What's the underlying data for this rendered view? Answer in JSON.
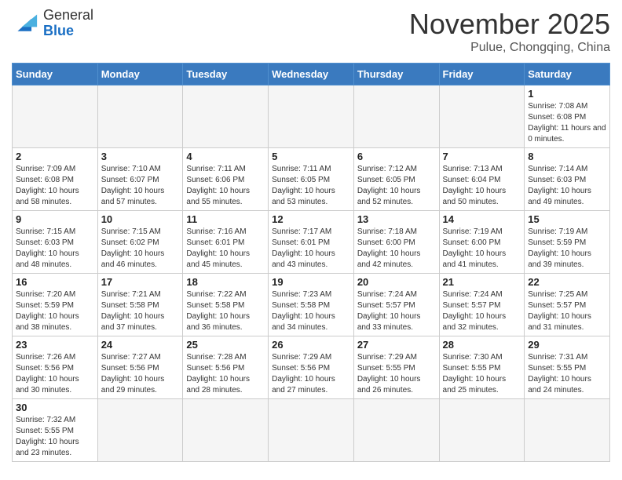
{
  "header": {
    "logo": {
      "general": "General",
      "blue": "Blue"
    },
    "title": "November 2025",
    "location": "Pulue, Chongqing, China"
  },
  "weekdays": [
    "Sunday",
    "Monday",
    "Tuesday",
    "Wednesday",
    "Thursday",
    "Friday",
    "Saturday"
  ],
  "weeks": [
    [
      {
        "day": null,
        "info": null
      },
      {
        "day": null,
        "info": null
      },
      {
        "day": null,
        "info": null
      },
      {
        "day": null,
        "info": null
      },
      {
        "day": null,
        "info": null
      },
      {
        "day": null,
        "info": null
      },
      {
        "day": "1",
        "info": "Sunrise: 7:08 AM\nSunset: 6:08 PM\nDaylight: 11 hours and 0 minutes."
      }
    ],
    [
      {
        "day": "2",
        "info": "Sunrise: 7:09 AM\nSunset: 6:08 PM\nDaylight: 10 hours and 58 minutes."
      },
      {
        "day": "3",
        "info": "Sunrise: 7:10 AM\nSunset: 6:07 PM\nDaylight: 10 hours and 57 minutes."
      },
      {
        "day": "4",
        "info": "Sunrise: 7:11 AM\nSunset: 6:06 PM\nDaylight: 10 hours and 55 minutes."
      },
      {
        "day": "5",
        "info": "Sunrise: 7:11 AM\nSunset: 6:05 PM\nDaylight: 10 hours and 53 minutes."
      },
      {
        "day": "6",
        "info": "Sunrise: 7:12 AM\nSunset: 6:05 PM\nDaylight: 10 hours and 52 minutes."
      },
      {
        "day": "7",
        "info": "Sunrise: 7:13 AM\nSunset: 6:04 PM\nDaylight: 10 hours and 50 minutes."
      },
      {
        "day": "8",
        "info": "Sunrise: 7:14 AM\nSunset: 6:03 PM\nDaylight: 10 hours and 49 minutes."
      }
    ],
    [
      {
        "day": "9",
        "info": "Sunrise: 7:15 AM\nSunset: 6:03 PM\nDaylight: 10 hours and 48 minutes."
      },
      {
        "day": "10",
        "info": "Sunrise: 7:15 AM\nSunset: 6:02 PM\nDaylight: 10 hours and 46 minutes."
      },
      {
        "day": "11",
        "info": "Sunrise: 7:16 AM\nSunset: 6:01 PM\nDaylight: 10 hours and 45 minutes."
      },
      {
        "day": "12",
        "info": "Sunrise: 7:17 AM\nSunset: 6:01 PM\nDaylight: 10 hours and 43 minutes."
      },
      {
        "day": "13",
        "info": "Sunrise: 7:18 AM\nSunset: 6:00 PM\nDaylight: 10 hours and 42 minutes."
      },
      {
        "day": "14",
        "info": "Sunrise: 7:19 AM\nSunset: 6:00 PM\nDaylight: 10 hours and 41 minutes."
      },
      {
        "day": "15",
        "info": "Sunrise: 7:19 AM\nSunset: 5:59 PM\nDaylight: 10 hours and 39 minutes."
      }
    ],
    [
      {
        "day": "16",
        "info": "Sunrise: 7:20 AM\nSunset: 5:59 PM\nDaylight: 10 hours and 38 minutes."
      },
      {
        "day": "17",
        "info": "Sunrise: 7:21 AM\nSunset: 5:58 PM\nDaylight: 10 hours and 37 minutes."
      },
      {
        "day": "18",
        "info": "Sunrise: 7:22 AM\nSunset: 5:58 PM\nDaylight: 10 hours and 36 minutes."
      },
      {
        "day": "19",
        "info": "Sunrise: 7:23 AM\nSunset: 5:58 PM\nDaylight: 10 hours and 34 minutes."
      },
      {
        "day": "20",
        "info": "Sunrise: 7:24 AM\nSunset: 5:57 PM\nDaylight: 10 hours and 33 minutes."
      },
      {
        "day": "21",
        "info": "Sunrise: 7:24 AM\nSunset: 5:57 PM\nDaylight: 10 hours and 32 minutes."
      },
      {
        "day": "22",
        "info": "Sunrise: 7:25 AM\nSunset: 5:57 PM\nDaylight: 10 hours and 31 minutes."
      }
    ],
    [
      {
        "day": "23",
        "info": "Sunrise: 7:26 AM\nSunset: 5:56 PM\nDaylight: 10 hours and 30 minutes."
      },
      {
        "day": "24",
        "info": "Sunrise: 7:27 AM\nSunset: 5:56 PM\nDaylight: 10 hours and 29 minutes."
      },
      {
        "day": "25",
        "info": "Sunrise: 7:28 AM\nSunset: 5:56 PM\nDaylight: 10 hours and 28 minutes."
      },
      {
        "day": "26",
        "info": "Sunrise: 7:29 AM\nSunset: 5:56 PM\nDaylight: 10 hours and 27 minutes."
      },
      {
        "day": "27",
        "info": "Sunrise: 7:29 AM\nSunset: 5:55 PM\nDaylight: 10 hours and 26 minutes."
      },
      {
        "day": "28",
        "info": "Sunrise: 7:30 AM\nSunset: 5:55 PM\nDaylight: 10 hours and 25 minutes."
      },
      {
        "day": "29",
        "info": "Sunrise: 7:31 AM\nSunset: 5:55 PM\nDaylight: 10 hours and 24 minutes."
      }
    ],
    [
      {
        "day": "30",
        "info": "Sunrise: 7:32 AM\nSunset: 5:55 PM\nDaylight: 10 hours and 23 minutes."
      },
      {
        "day": null,
        "info": null
      },
      {
        "day": null,
        "info": null
      },
      {
        "day": null,
        "info": null
      },
      {
        "day": null,
        "info": null
      },
      {
        "day": null,
        "info": null
      },
      {
        "day": null,
        "info": null
      }
    ]
  ]
}
